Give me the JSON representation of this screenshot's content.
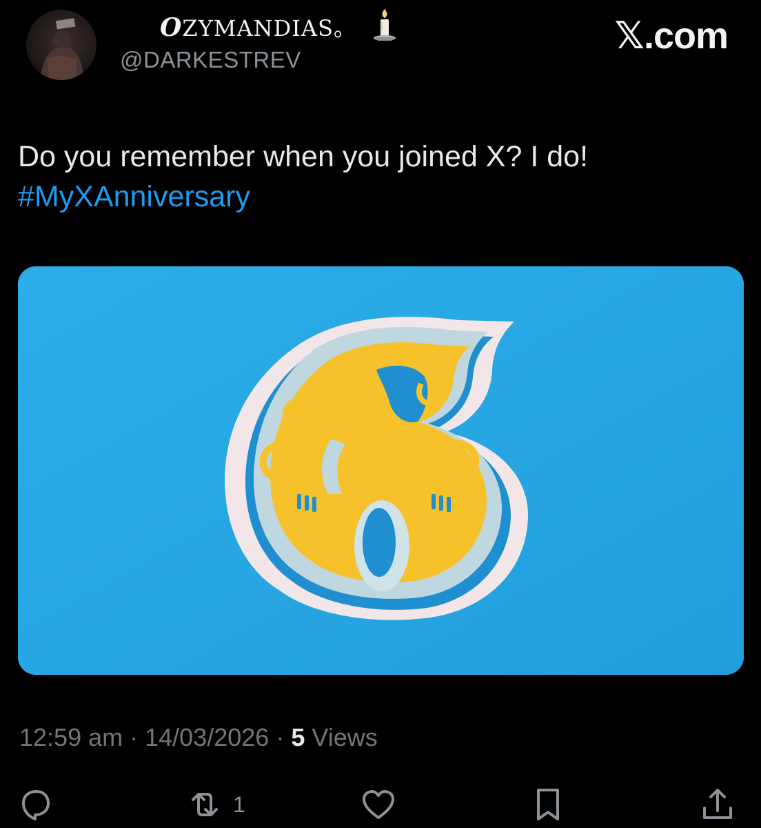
{
  "author": {
    "display_name_lead": "O",
    "display_name_rest": "ZYMANDIAS。",
    "handle": "@DARKESTREV"
  },
  "brand": "𝕏.com",
  "post": {
    "text": "Do you remember when you joined X? I do!",
    "hashtag": "#MyXAnniversary",
    "media_icon": "paper-cut-number-six-artwork"
  },
  "meta": {
    "time": "12:59 am",
    "date": "14/03/2026",
    "views_count": "5",
    "views_label": "Views",
    "separator": "·"
  },
  "actions": {
    "reply_icon": "reply-icon",
    "repost_icon": "repost-icon",
    "repost_count": "1",
    "like_icon": "heart-icon",
    "bookmark_icon": "bookmark-icon",
    "share_icon": "share-icon"
  },
  "colors": {
    "background": "#000000",
    "link": "#1d9bf0",
    "media_background": "#27a7e5",
    "muted": "#71767b"
  }
}
